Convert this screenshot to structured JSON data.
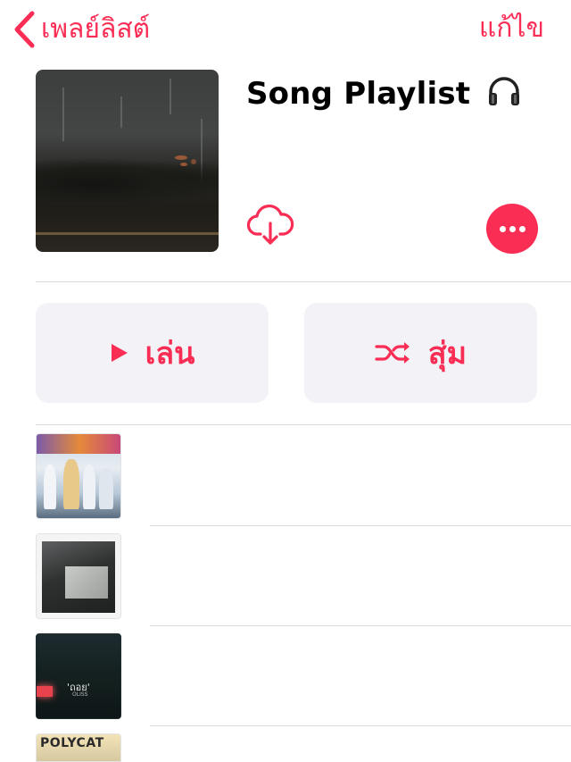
{
  "nav": {
    "back_label": "เพลย์ลิสต์",
    "edit_label": "แก้ไข"
  },
  "playlist": {
    "title": "Song Playlist",
    "title_icon": "headphones-icon",
    "cover_icon": "playlist-cover-image"
  },
  "actions": {
    "download_icon": "cloud-download-icon",
    "more_icon": "ellipsis-icon",
    "play_label": "เล่น",
    "play_icon": "play-icon",
    "shuffle_label": "สุ่ม",
    "shuffle_icon": "shuffle-icon"
  },
  "tracks": [
    {
      "artwork": "album-artwork-1"
    },
    {
      "artwork": "album-artwork-2"
    },
    {
      "artwork": "album-artwork-3",
      "cover_text": "'ถอย'",
      "cover_subtext": "OLISS"
    },
    {
      "artwork": "album-artwork-4",
      "cover_text": "POLYCAT"
    }
  ],
  "colors": {
    "accent": "#fa2d55",
    "button_bg": "#f2f2f7",
    "separator": "#d8d8dc"
  }
}
